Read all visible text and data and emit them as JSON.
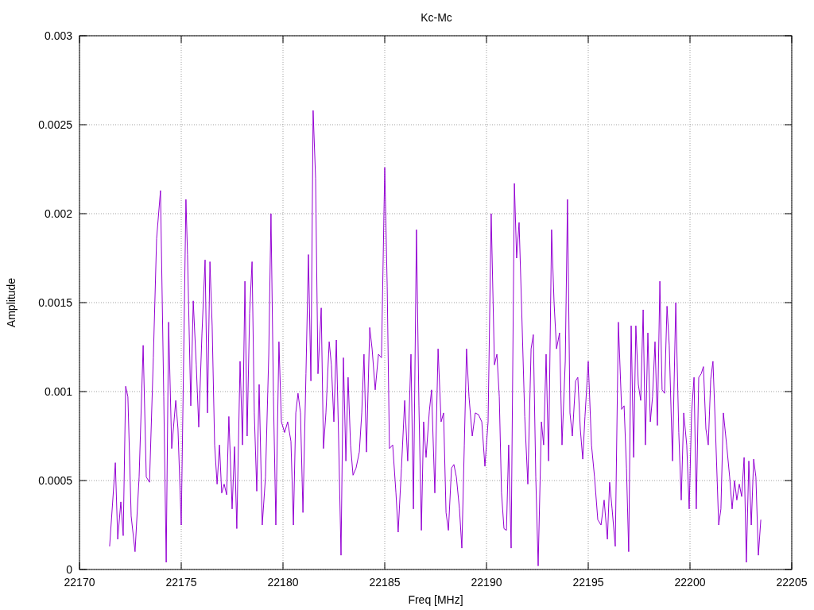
{
  "chart_data": {
    "type": "line",
    "title": "Kc-Mc",
    "xlabel": "Freq [MHz]",
    "ylabel": "Amplitude",
    "xlim": [
      22170,
      22205
    ],
    "grid": true,
    "ylim": [
      0,
      0.003
    ],
    "xticks": [
      22170,
      22175,
      22180,
      22185,
      22190,
      22195,
      22200,
      22205
    ],
    "yticks": [
      0,
      0.0005,
      0.001,
      0.0015,
      0.002,
      0.0025,
      0.003
    ],
    "x": [
      22171.48,
      22171.76,
      22171.88,
      22172.03,
      22172.15,
      22172.27,
      22172.38,
      22172.54,
      22172.73,
      22172.93,
      22173.13,
      22173.28,
      22173.44,
      22173.63,
      22173.79,
      22173.98,
      22174.14,
      22174.26,
      22174.38,
      22174.53,
      22174.73,
      22174.84,
      22175.0,
      22175.23,
      22175.31,
      22175.47,
      22175.59,
      22175.74,
      22175.86,
      22176.02,
      22176.17,
      22176.29,
      22176.41,
      22176.52,
      22176.64,
      22176.76,
      22176.88,
      22176.99,
      22177.11,
      22177.23,
      22177.34,
      22177.5,
      22177.62,
      22177.73,
      22177.89,
      22178.01,
      22178.13,
      22178.24,
      22178.36,
      22178.48,
      22178.59,
      22178.71,
      22178.83,
      22178.98,
      22179.14,
      22179.3,
      22179.41,
      22179.53,
      22179.65,
      22179.8,
      22179.92,
      22180.08,
      22180.23,
      22180.39,
      22180.51,
      22180.63,
      22180.74,
      22180.86,
      22180.98,
      22181.13,
      22181.25,
      22181.37,
      22181.48,
      22181.6,
      22181.72,
      22181.88,
      22181.99,
      22182.11,
      22182.27,
      22182.38,
      22182.5,
      22182.62,
      22182.73,
      22182.85,
      22182.97,
      22183.09,
      22183.2,
      22183.32,
      22183.44,
      22183.59,
      22183.75,
      22183.87,
      22183.98,
      22184.1,
      22184.26,
      22184.38,
      22184.53,
      22184.69,
      22184.84,
      22185.0,
      22185.12,
      22185.23,
      22185.39,
      22185.55,
      22185.66,
      22185.82,
      22185.98,
      22186.13,
      22186.29,
      22186.41,
      22186.56,
      22186.68,
      22186.8,
      22186.91,
      22187.03,
      22187.19,
      22187.3,
      22187.46,
      22187.62,
      22187.77,
      22187.89,
      22188.01,
      22188.13,
      22188.28,
      22188.4,
      22188.52,
      22188.67,
      22188.79,
      22188.91,
      22189.02,
      22189.14,
      22189.3,
      22189.45,
      22189.61,
      22189.77,
      22189.92,
      22190.08,
      22190.23,
      22190.39,
      22190.51,
      22190.63,
      22190.74,
      22190.86,
      22190.98,
      22191.09,
      22191.21,
      22191.37,
      22191.48,
      22191.6,
      22191.72,
      22191.88,
      22192.03,
      22192.19,
      22192.3,
      22192.42,
      22192.54,
      22192.7,
      22192.81,
      22192.93,
      22193.05,
      22193.2,
      22193.32,
      22193.44,
      22193.59,
      22193.71,
      22193.87,
      22193.98,
      22194.1,
      22194.22,
      22194.38,
      22194.49,
      22194.61,
      22194.73,
      22194.84,
      22195.0,
      22195.16,
      22195.31,
      22195.47,
      22195.63,
      22195.78,
      22195.94,
      22196.05,
      22196.17,
      22196.33,
      22196.48,
      22196.64,
      22196.76,
      22196.88,
      22196.99,
      22197.11,
      22197.23,
      22197.34,
      22197.46,
      22197.58,
      22197.7,
      22197.81,
      22197.93,
      22198.05,
      22198.16,
      22198.28,
      22198.4,
      22198.52,
      22198.63,
      22198.75,
      22198.87,
      22198.98,
      22199.14,
      22199.3,
      22199.45,
      22199.57,
      22199.69,
      22199.84,
      22199.96,
      22200.08,
      22200.2,
      22200.31,
      22200.43,
      22200.55,
      22200.66,
      22200.78,
      22200.9,
      22201.02,
      22201.13,
      22201.25,
      22201.41,
      22201.52,
      22201.64,
      22201.8,
      22201.95,
      22202.07,
      22202.19,
      22202.3,
      22202.42,
      22202.54,
      22202.66,
      22202.77,
      22202.89,
      22203.01,
      22203.13,
      22203.24,
      22203.36,
      22203.48
    ],
    "series": [
      {
        "color": "#9400d3",
        "values": [
          0.00013,
          0.0006,
          0.00017,
          0.00038,
          0.00019,
          0.00103,
          0.00097,
          0.0003,
          0.0001,
          0.00052,
          0.00126,
          0.00052,
          0.00049,
          0.00119,
          0.00186,
          0.00213,
          0.00097,
          4e-05,
          0.00139,
          0.00068,
          0.00095,
          0.00079,
          0.00025,
          0.00208,
          0.00177,
          0.00092,
          0.00151,
          0.00115,
          0.0008,
          0.00133,
          0.00174,
          0.00088,
          0.00173,
          0.00137,
          0.0007,
          0.00048,
          0.0007,
          0.00043,
          0.00048,
          0.00042,
          0.00086,
          0.00034,
          0.00069,
          0.00023,
          0.00117,
          0.0007,
          0.00162,
          0.00075,
          0.00144,
          0.00173,
          0.00088,
          0.00044,
          0.00104,
          0.00025,
          0.00052,
          0.00121,
          0.002,
          0.00097,
          0.00025,
          0.00128,
          0.00083,
          0.00077,
          0.00083,
          0.00072,
          0.00025,
          0.00088,
          0.00099,
          0.00088,
          0.00032,
          0.0011,
          0.00177,
          0.00106,
          0.00258,
          0.0022,
          0.0011,
          0.00147,
          0.00068,
          0.00088,
          0.00128,
          0.00115,
          0.00083,
          0.00129,
          0.00075,
          8e-05,
          0.00119,
          0.00061,
          0.00108,
          0.0007,
          0.00053,
          0.00057,
          0.00066,
          0.00088,
          0.00121,
          0.00066,
          0.00136,
          0.00124,
          0.00101,
          0.00121,
          0.00119,
          0.00226,
          0.00159,
          0.00068,
          0.0007,
          0.00043,
          0.00021,
          0.00057,
          0.00095,
          0.00061,
          0.00121,
          0.00034,
          0.00191,
          0.00092,
          0.00022,
          0.00083,
          0.00063,
          0.00089,
          0.00101,
          0.00043,
          0.00124,
          0.00083,
          0.00088,
          0.00032,
          0.00022,
          0.00057,
          0.00059,
          0.00052,
          0.00034,
          0.00012,
          0.0007,
          0.00124,
          0.00097,
          0.00075,
          0.00088,
          0.00087,
          0.00083,
          0.00058,
          0.00083,
          0.002,
          0.00115,
          0.00121,
          0.00097,
          0.00043,
          0.00023,
          0.00022,
          0.0007,
          0.00012,
          0.00217,
          0.00175,
          0.00195,
          0.0015,
          0.00086,
          0.00048,
          0.00124,
          0.00132,
          0.00052,
          2e-05,
          0.00083,
          0.0007,
          0.00121,
          0.00061,
          0.00191,
          0.0015,
          0.00124,
          0.00133,
          0.0007,
          0.00117,
          0.00208,
          0.00088,
          0.00075,
          0.00106,
          0.00108,
          0.00079,
          0.00062,
          0.00086,
          0.00117,
          0.0007,
          0.00052,
          0.00028,
          0.00025,
          0.00039,
          0.00017,
          0.00049,
          0.00034,
          0.00013,
          0.00139,
          0.0009,
          0.00092,
          0.00057,
          0.0001,
          0.00137,
          0.00063,
          0.00137,
          0.00104,
          0.00095,
          0.00146,
          0.0007,
          0.00133,
          0.00083,
          0.00097,
          0.00128,
          0.00081,
          0.00162,
          0.00101,
          0.00099,
          0.00148,
          0.00126,
          0.00061,
          0.0015,
          0.00077,
          0.00039,
          0.00088,
          0.0007,
          0.00034,
          0.00088,
          0.00108,
          0.00034,
          0.00108,
          0.0011,
          0.00114,
          0.00079,
          0.0007,
          0.00107,
          0.00117,
          0.00079,
          0.00025,
          0.00034,
          0.00088,
          0.0007,
          0.00052,
          0.00034,
          0.0005,
          0.00039,
          0.00048,
          0.00041,
          0.00063,
          4e-05,
          0.00061,
          0.00025,
          0.00062,
          0.00052,
          8e-05,
          0.00028
        ]
      }
    ]
  }
}
